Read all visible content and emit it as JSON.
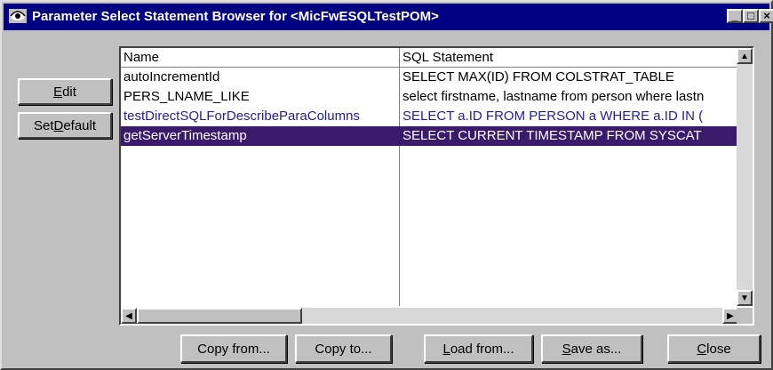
{
  "window": {
    "title": "Parameter Select Statement Browser for <MicFwESQLTestPOM>",
    "controls": {
      "minimize": "_",
      "maximize": "□",
      "close": "×"
    }
  },
  "side_buttons": {
    "edit": {
      "pre": "",
      "key": "E",
      "post": "dit"
    },
    "set_default": {
      "pre": "Set ",
      "key": "D",
      "post": "efault"
    }
  },
  "table": {
    "columns": [
      "Name",
      "SQL Statement"
    ],
    "rows": [
      {
        "name": "autoIncrementId",
        "sql": "SELECT MAX(ID) FROM COLSTRAT_TABLE",
        "color": "#000000"
      },
      {
        "name": "PERS_LNAME_LIKE",
        "sql": "select firstname, lastname from person where lastn",
        "color": "#000000"
      },
      {
        "name": "testDirectSQLForDescribeParaColumns",
        "sql": "SELECT a.ID FROM PERSON a WHERE a.ID IN (",
        "color": "#2020a0"
      },
      {
        "name": "getServerTimestamp",
        "sql": "SELECT CURRENT TIMESTAMP FROM SYSCAT",
        "color": "#ffffff"
      }
    ],
    "selected_index": 3
  },
  "bottom_buttons": {
    "copy_from": "Copy from...",
    "copy_to": "Copy to...",
    "load_from": {
      "pre": "",
      "key": "L",
      "post": "oad from..."
    },
    "save_as": {
      "pre": "",
      "key": "S",
      "post": "ave as..."
    },
    "close": {
      "pre": "",
      "key": "C",
      "post": "lose"
    }
  },
  "colors": {
    "title_bg": "#000080",
    "selection_bg": "#3a1a6a",
    "face": "#c0c0c0"
  }
}
